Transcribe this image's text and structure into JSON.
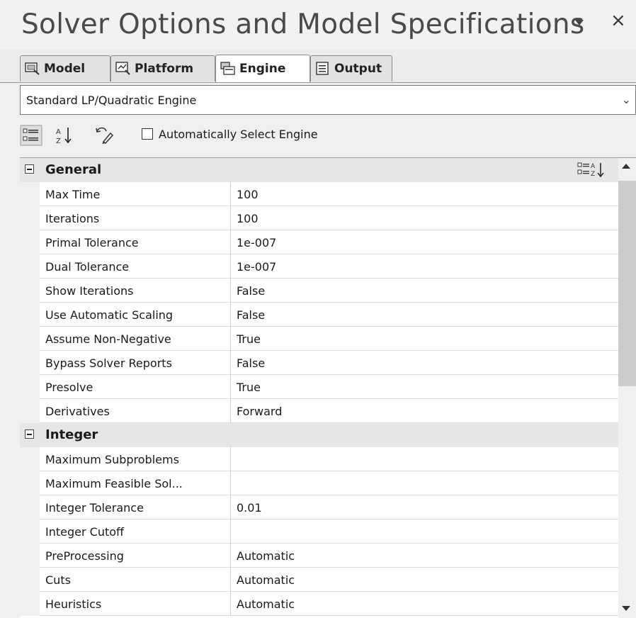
{
  "window": {
    "title": "Solver Options and Model Specifications",
    "dropdown_icon": "triangle-down-icon",
    "close_glyph": "×"
  },
  "tabs": [
    {
      "label": "Model",
      "icon": "model-icon",
      "active": false
    },
    {
      "label": "Platform",
      "icon": "platform-icon",
      "active": false
    },
    {
      "label": "Engine",
      "icon": "engine-icon",
      "active": true
    },
    {
      "label": "Output",
      "icon": "output-icon",
      "active": false
    }
  ],
  "engine_select": {
    "value": "Standard LP/Quadratic Engine",
    "chevron": "⌄"
  },
  "toolbar": {
    "categorized_icon": "categorized-view-icon",
    "sort_az_icon": "sort-alphabetical-icon",
    "reset_icon": "reset-icon",
    "auto_select_checked": false,
    "auto_select_label": "Automatically Select Engine"
  },
  "grid": {
    "categories": [
      {
        "label": "General",
        "properties": [
          {
            "name": "Max Time",
            "value": "100"
          },
          {
            "name": "Iterations",
            "value": "100"
          },
          {
            "name": "Primal Tolerance",
            "value": "1e-007"
          },
          {
            "name": "Dual Tolerance",
            "value": "1e-007"
          },
          {
            "name": "Show Iterations",
            "value": "False"
          },
          {
            "name": "Use Automatic Scaling",
            "value": "False"
          },
          {
            "name": "Assume Non-Negative",
            "value": "True"
          },
          {
            "name": "Bypass Solver Reports",
            "value": "False"
          },
          {
            "name": "Presolve",
            "value": "True"
          },
          {
            "name": "Derivatives",
            "value": "Forward"
          }
        ]
      },
      {
        "label": "Integer",
        "properties": [
          {
            "name": "Maximum Subproblems",
            "value": ""
          },
          {
            "name": "Maximum Feasible Sol...",
            "value": ""
          },
          {
            "name": "Integer Tolerance",
            "value": "0.01"
          },
          {
            "name": "Integer Cutoff",
            "value": ""
          },
          {
            "name": "PreProcessing",
            "value": "Automatic"
          },
          {
            "name": "Cuts",
            "value": "Automatic"
          },
          {
            "name": "Heuristics",
            "value": "Automatic"
          }
        ]
      }
    ]
  },
  "colors": {
    "background": "#efefef",
    "category_row": "#e6e6e6",
    "scroll_thumb": "#cbcbcb"
  }
}
